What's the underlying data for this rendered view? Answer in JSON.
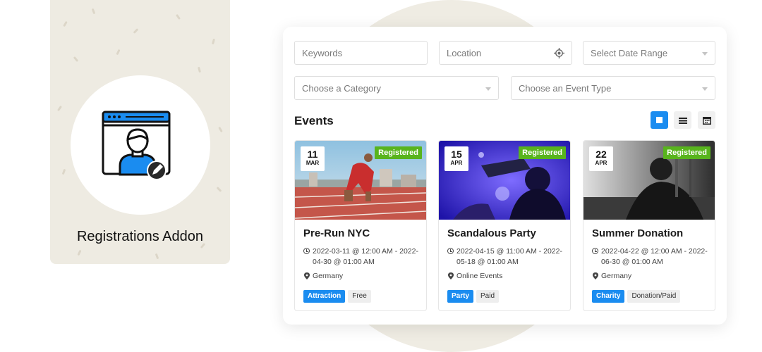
{
  "promo": {
    "title": "Registrations Addon",
    "icon": "user-edit-icon"
  },
  "filters": {
    "keywords_placeholder": "Keywords",
    "location_placeholder": "Location",
    "date_range_placeholder": "Select Date Range",
    "category_placeholder": "Choose a Category",
    "event_type_placeholder": "Choose an Event Type"
  },
  "events_section": {
    "title": "Events",
    "views": [
      "grid-view-icon",
      "list-view-icon",
      "calendar-view-icon"
    ]
  },
  "events": [
    {
      "day": "11",
      "month": "MAR",
      "badge": "Registered",
      "title": "Pre-Run NYC",
      "time": "2022-03-11 @ 12:00 AM - 2022-04-30 @ 01:00 AM",
      "location": "Germany",
      "tags": [
        "Attraction",
        "Free"
      ]
    },
    {
      "day": "15",
      "month": "APR",
      "badge": "Registered",
      "title": "Scandalous Party",
      "time": "2022-04-15 @ 11:00 AM - 2022-05-18 @ 01:00 AM",
      "location": "Online Events",
      "tags": [
        "Party",
        "Paid"
      ]
    },
    {
      "day": "22",
      "month": "APR",
      "badge": "Registered",
      "title": "Summer Donation",
      "time": "2022-04-22 @ 12:00 AM - 2022-06-30 @ 01:00 AM",
      "location": "Germany",
      "tags": [
        "Charity",
        "Donation/Paid"
      ]
    }
  ],
  "colors": {
    "accent": "#1a8cf0",
    "registered": "#58b41d",
    "promo_bg": "#eeebe2"
  }
}
